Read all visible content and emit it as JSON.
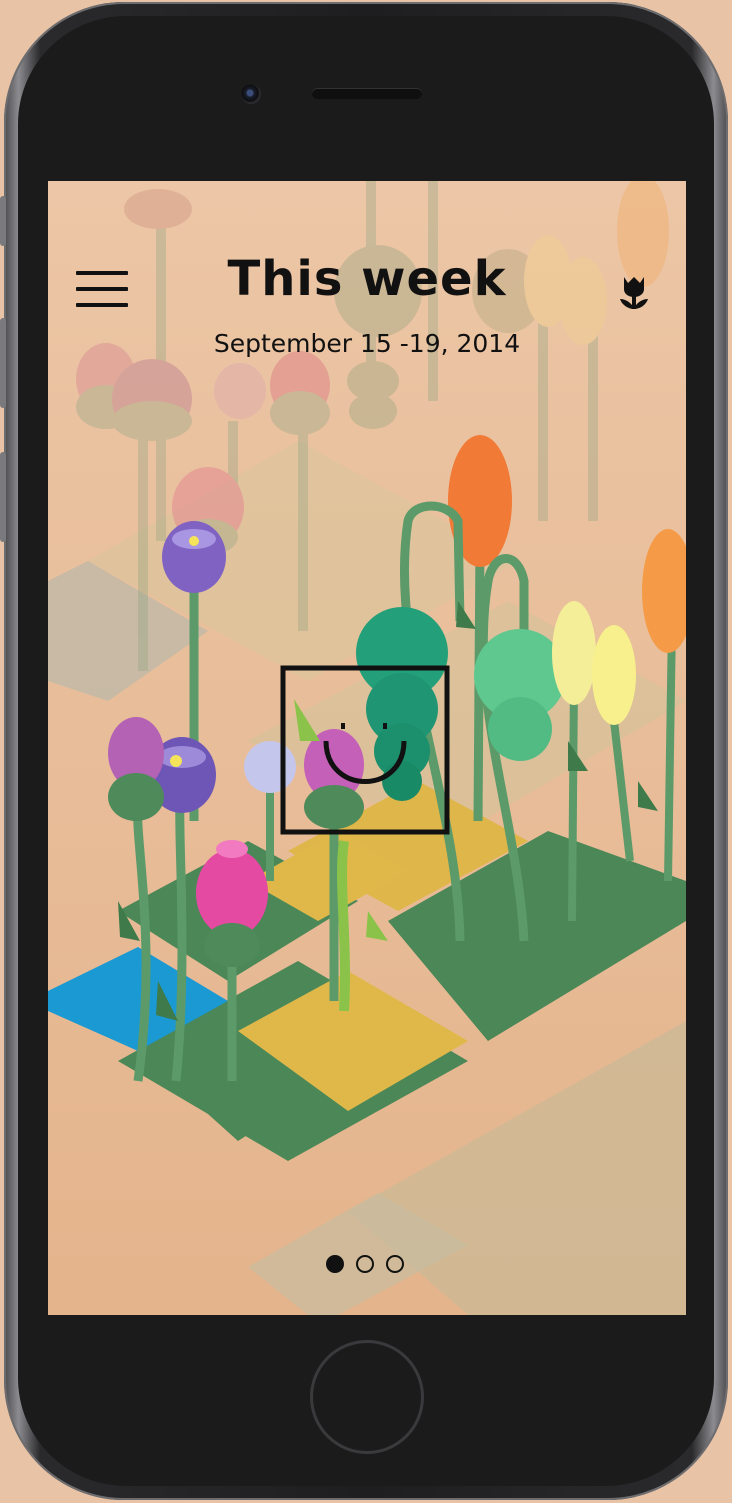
{
  "header": {
    "title": "This week",
    "date_range": "September 15 -19, 2014",
    "menu_icon": "hamburger-menu-icon",
    "garden_icon": "tulip-flower-icon"
  },
  "mood": {
    "icon": "smiley-face-icon"
  },
  "pagination": {
    "total": 3,
    "active_index": 0
  },
  "colors": {
    "background": "#e9c2a2",
    "text": "#111111",
    "leaf_green": "#4f8a5a",
    "tile_green": "#4d8a5a",
    "tile_yellow": "#e2b84a",
    "tile_blue": "#1d9ad0"
  }
}
